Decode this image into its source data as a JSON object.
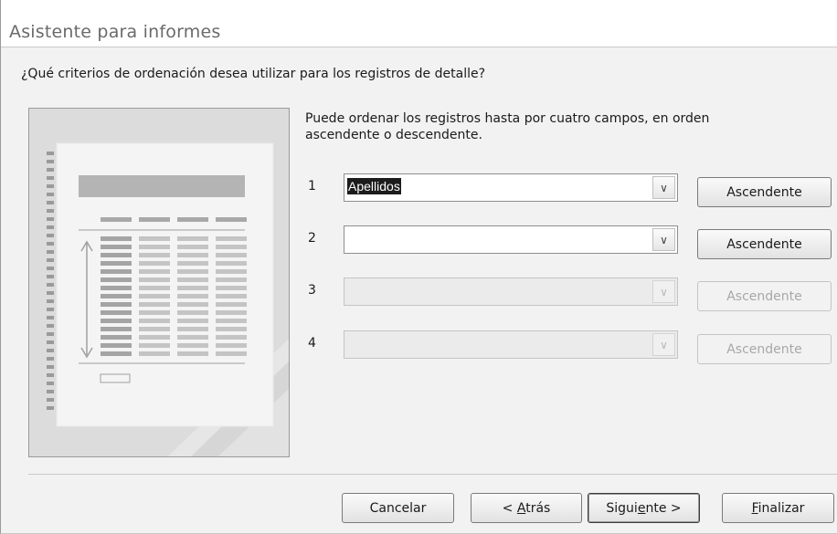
{
  "window": {
    "title": "Asistente para informes"
  },
  "question": "¿Qué criterios de ordenación desea utilizar para los registros de detalle?",
  "instructions": "Puede ordenar los registros hasta por cuatro campos, en orden ascendente o descendente.",
  "sort_rows": [
    {
      "number": "1",
      "field": "Apellidos",
      "order": "Ascendente",
      "enabled": true,
      "selected": true
    },
    {
      "number": "2",
      "field": "",
      "order": "Ascendente",
      "enabled": true,
      "selected": false
    },
    {
      "number": "3",
      "field": "",
      "order": "Ascendente",
      "enabled": false,
      "selected": false
    },
    {
      "number": "4",
      "field": "",
      "order": "Ascendente",
      "enabled": false,
      "selected": false
    }
  ],
  "buttons": {
    "cancel": "Cancelar",
    "back_prefix": "< ",
    "back_key": "A",
    "back_rest": "trás",
    "next_prefix": "Sigui",
    "next_key": "e",
    "next_rest": "nte >",
    "finish_key": "F",
    "finish_rest": "inalizar"
  },
  "icons": {
    "dropdown": "chevron-down-icon"
  }
}
